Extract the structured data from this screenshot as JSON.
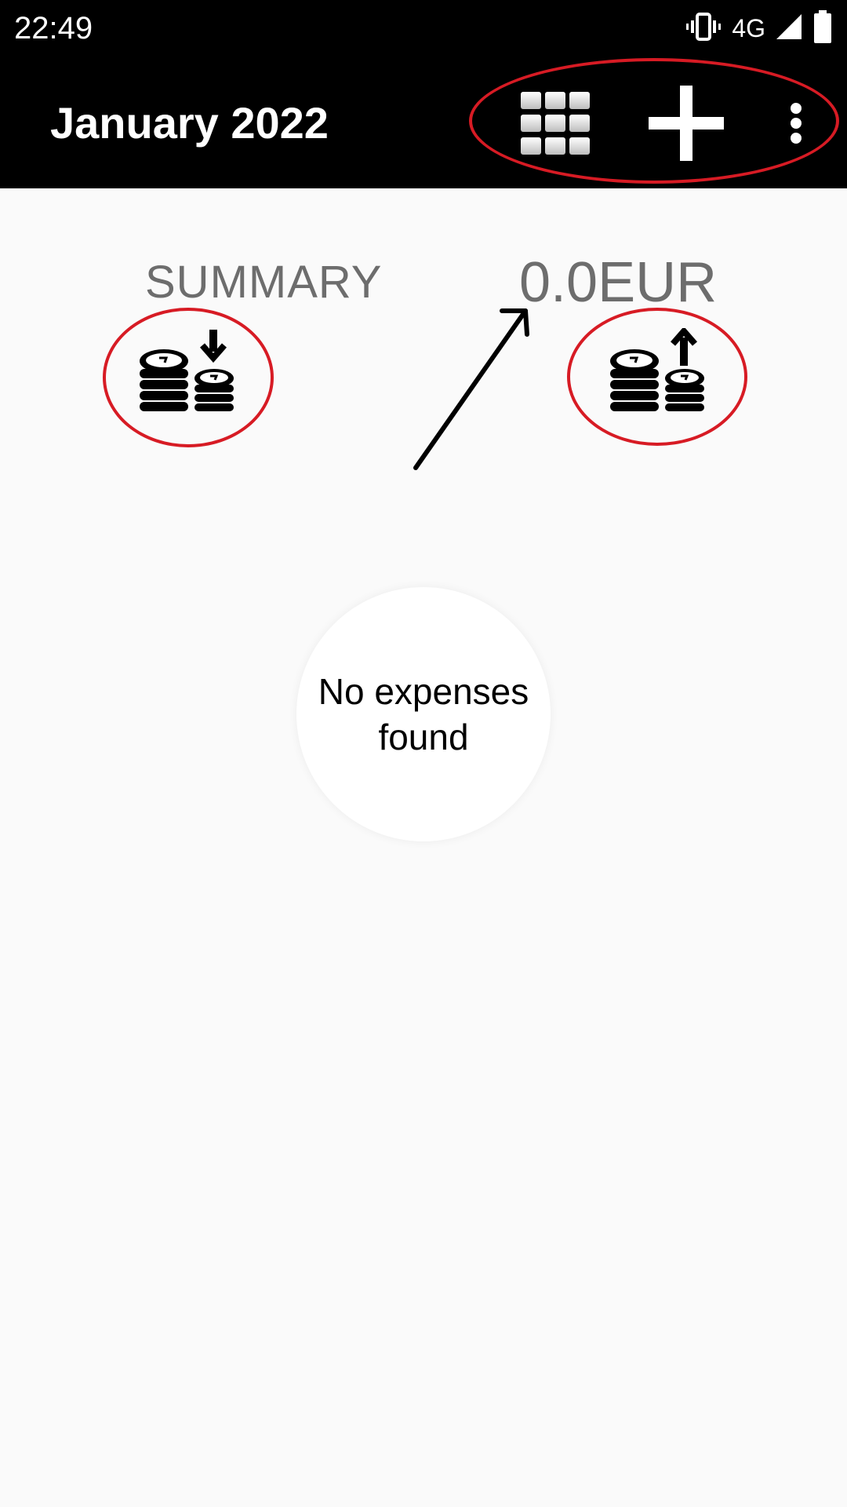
{
  "status_bar": {
    "time": "22:49",
    "network": "4G",
    "icons": [
      "vibrate-icon",
      "signal-icon",
      "battery-icon"
    ]
  },
  "app_bar": {
    "title": "January 2022",
    "actions": [
      "grid-icon",
      "add-icon",
      "more-vert-icon"
    ]
  },
  "summary": {
    "label": "SUMMARY",
    "total": "0.0EUR",
    "income_icon": "coins-down-icon",
    "expense_icon": "coins-up-icon"
  },
  "empty_state": {
    "message": "No expenses found"
  },
  "colors": {
    "bar_background": "#000000",
    "page_background": "#fafafa",
    "muted_text": "#6d6d6d",
    "annotation_red": "#d71b24"
  }
}
